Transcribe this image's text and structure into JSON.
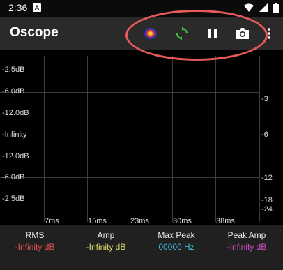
{
  "status": {
    "time": "2:36",
    "badge": "A"
  },
  "app": {
    "title": "Oscope"
  },
  "actions": [
    "heatmap-icon",
    "sync-icon",
    "pause-icon",
    "camera-icon",
    "overflow-icon"
  ],
  "colors": {
    "accent_ring": "#e85a5a",
    "sync": "#3fbf3f",
    "rms": "#e05050",
    "amp": "#d8d86a",
    "maxpeak": "#3fb6d8",
    "peakamp": "#d04fc4"
  },
  "plot": {
    "left_labels": [
      "-2.5dB",
      "-6.0dB",
      "-12.0dB",
      "-Infinity",
      "-12.0dB",
      "-6.0dB",
      "-2.5dB"
    ],
    "right_labels": [
      "-3",
      "-6",
      "-12",
      "-18",
      "-24"
    ],
    "x_labels": [
      "7ms",
      "15ms",
      "23ms",
      "30ms",
      "38ms"
    ]
  },
  "stats": [
    {
      "name": "RMS",
      "value": "-Infinity dB"
    },
    {
      "name": "Amp",
      "value": "-Infinity dB"
    },
    {
      "name": "Max Peak",
      "value": "00000 Hz"
    },
    {
      "name": "Peak Amp",
      "value": "-Infinity dB"
    }
  ]
}
